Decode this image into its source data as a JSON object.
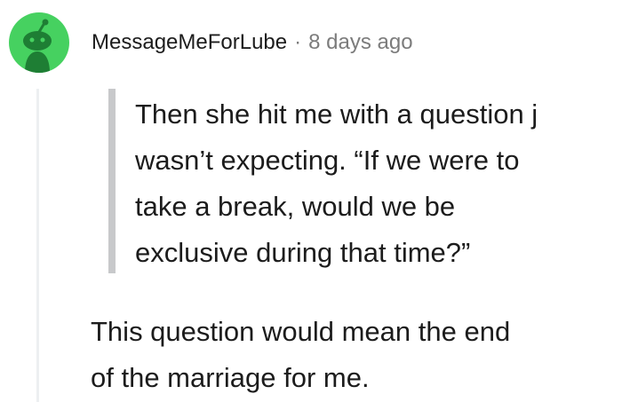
{
  "comment": {
    "avatar_icon": "reddit-snoo-avatar-icon",
    "avatar_color": "#46d160",
    "author": "MessageMeForLube",
    "separator": "·",
    "timestamp": "8 days ago",
    "quote_lines": [
      "Then she hit me with a question j",
      "wasn’t expecting. “If we were to",
      "take a break, would we be",
      "exclusive during that time?”"
    ],
    "body_lines": [
      "This question would mean the end",
      "of the marriage for me."
    ]
  }
}
